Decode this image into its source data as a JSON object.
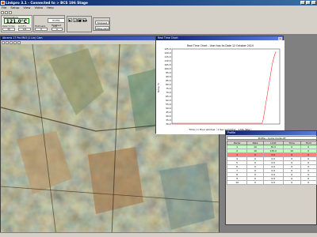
{
  "window": {
    "title": "Linkpro 3.1 - Connected to > BCS 196 Stage"
  },
  "menu": [
    "File",
    "Setup",
    "View",
    "Video",
    "Help"
  ],
  "panel": {
    "temp_label": "Temperature",
    "temperature": "121.0°C",
    "rate_label": "Rate°C/min",
    "limit_label": "Limit°C",
    "hold_label": "Hold secs",
    "lnp_label": "Lnp",
    "rate": "30",
    "limit": "121",
    "hold": "0",
    "lnp": "A",
    "profile_status": "Profile finished",
    "transport": [
      "▶",
      "❙❙",
      "■",
      "▶▶"
    ],
    "stopped": "Stopped",
    "delay_label": "Delay secs"
  },
  "camera": {
    "title": "Abrams 17 Pro Mk3 (1 Lin) Cam"
  },
  "chart": {
    "window_title": "Real Time Chart",
    "title": "Real Time Chart - User has its   Date 12 October 2010",
    "xlabel": "Time ( 1 Hour window - 1 Sec sampling - 1 Mb data )",
    "ylabel": "Temp °C",
    "y_ticks": [
      "125.0",
      "120.0",
      "115.0",
      "110.0",
      "105.0",
      "100.0",
      "95.0",
      "90.0",
      "85.0",
      "80.0",
      "75.0",
      "70.0",
      "65.0",
      "60.0",
      "55.0",
      "50.0",
      "45.0",
      "40.0",
      "35.0",
      "30.0"
    ]
  },
  "chart_data": {
    "type": "line",
    "title": "Real Time Chart - User has its   Date 12 October 2010",
    "xlabel": "Time ( 1 Hour window - 1 Sec sampling - 1 Mb data )",
    "ylabel": "Temp °C",
    "ylim": [
      30,
      125
    ],
    "series": [
      {
        "values": [
          31,
          31,
          31,
          31,
          31,
          31,
          31,
          31,
          31,
          31,
          31,
          31,
          31,
          31,
          31,
          31,
          31,
          31,
          31,
          31,
          31,
          31,
          31,
          31,
          31,
          31,
          31,
          31,
          31,
          31,
          31,
          31,
          31,
          31,
          31,
          31,
          31,
          31,
          31,
          31,
          31,
          31,
          31,
          31,
          31,
          31,
          31,
          31,
          31,
          31,
          31,
          31,
          31,
          31,
          31,
          31,
          31,
          31,
          31,
          31,
          31,
          31,
          31,
          31,
          31,
          31,
          31,
          31,
          35,
          43,
          51,
          59,
          67,
          75,
          83,
          91,
          99,
          107,
          112,
          117,
          121,
          121
        ]
      }
    ],
    "grid": false
  },
  "profile": {
    "window_title": "Profile",
    "header": "Profile - Cycle mode off",
    "columns": [
      "Ramp",
      "Rate",
      "Limit",
      "Time",
      "Hold"
    ],
    "rows": [
      {
        "cells": [
          "1",
          "10",
          "30.0",
          "0",
          "0"
        ],
        "state": "done"
      },
      {
        "cells": [
          "2",
          "10",
          "130.0",
          "10",
          "0"
        ],
        "state": "done"
      },
      {
        "cells": [
          "3",
          "0",
          "0.0",
          "0",
          "0"
        ],
        "state": "active"
      },
      {
        "cells": [
          "4",
          "0",
          "0.0",
          "0",
          "0"
        ],
        "state": ""
      },
      {
        "cells": [
          "5",
          "0",
          "0.0",
          "0",
          "0"
        ],
        "state": ""
      },
      {
        "cells": [
          "6",
          "0",
          "0.0",
          "0",
          "0"
        ],
        "state": ""
      },
      {
        "cells": [
          "7",
          "0",
          "0.0",
          "0",
          "0"
        ],
        "state": ""
      },
      {
        "cells": [
          "8",
          "0",
          "0.0",
          "0",
          "0"
        ],
        "state": ""
      },
      {
        "cells": [
          "9",
          "0",
          "0.0",
          "0",
          "0"
        ],
        "state": ""
      },
      {
        "cells": [
          "10",
          "0",
          "0.0",
          "0",
          "0"
        ],
        "state": ""
      }
    ]
  }
}
